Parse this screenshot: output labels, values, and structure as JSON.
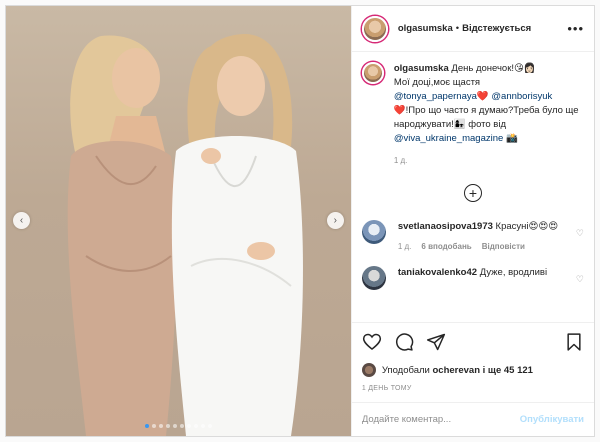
{
  "post": {
    "username": "olgasumska",
    "separator": "•",
    "follow_status": "Відстежується",
    "more_icon": "more-horizontal-icon"
  },
  "caption": {
    "username": "olgasumska",
    "text_1": "День донечок!😘👩🏻",
    "text_2": "Мої доці,моє щастя",
    "mention_1": "@tonya_papernaya",
    "heart": "❤️",
    "mention_2": "@annborisyuk",
    "text_3": "❤️!Про що часто я думаю?Треба було ще народжувати!👩‍👧 фото від",
    "mention_3": "@viva_ukraine_magazine",
    "camera": "📸",
    "age": "1 д."
  },
  "load_more_icon": "plus-circle-icon",
  "comments": [
    {
      "username": "svetlanaosipova1973",
      "text": "Красуні😍😍😍",
      "age": "1 д.",
      "likes": "6 вподобань",
      "reply": "Відповісти"
    },
    {
      "username": "taniakovalenko42",
      "text": "Дуже, вродливі",
      "age": "",
      "likes": "",
      "reply": ""
    }
  ],
  "actions": {
    "like_icon": "heart-icon",
    "comment_icon": "comment-icon",
    "share_icon": "send-icon",
    "save_icon": "bookmark-icon"
  },
  "likes": {
    "prefix": "Уподобали",
    "user": "ocherevan",
    "suffix": "і ще 45 121"
  },
  "timestamp": "1 ДЕНЬ ТОМУ",
  "add_comment": {
    "placeholder": "Додайте коментар...",
    "publish": "Опублікувати"
  },
  "carousel": {
    "count": 10,
    "active_index": 0
  },
  "colors": {
    "accent": "#3897f0",
    "publish_disabled": "#b2dffc",
    "meta": "#8e8e8e",
    "link": "#00376b"
  }
}
